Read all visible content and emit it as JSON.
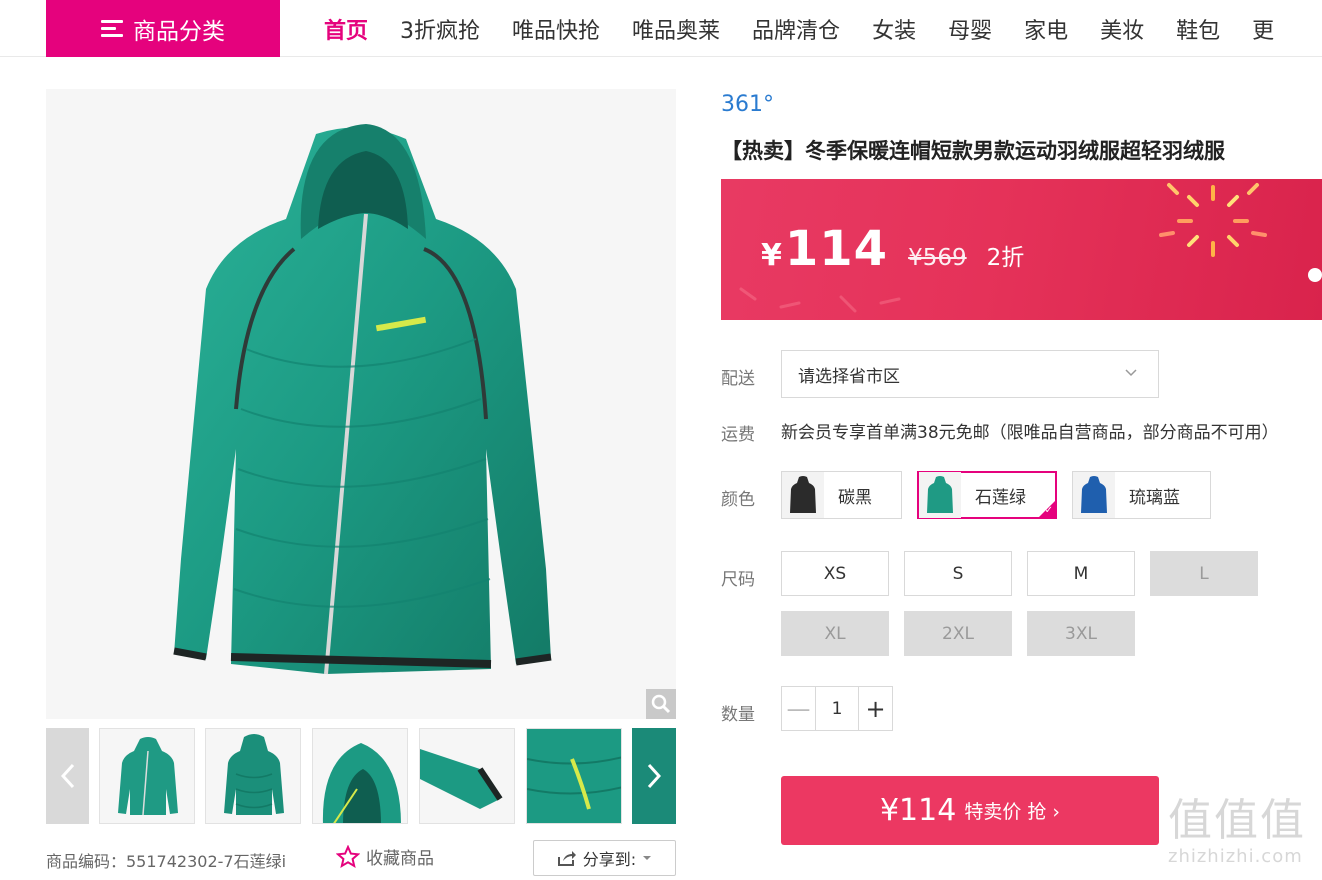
{
  "nav": {
    "category_button": "商品分类",
    "links": [
      "首页",
      "3折疯抢",
      "唯品快抢",
      "唯品奥莱",
      "品牌清仓",
      "女装",
      "母婴",
      "家电",
      "美妆",
      "鞋包",
      "更"
    ],
    "active_index": 0
  },
  "gallery": {
    "product_color_hex": "#1f9a84",
    "zoom_icon": "magnifier-icon",
    "thumbnail_count": 6
  },
  "product": {
    "brand": "361°",
    "title": "【热卖】冬季保暖连帽短款男款运动羽绒服超轻羽绒服",
    "currency": "¥",
    "price": "114",
    "original_price": "¥569",
    "discount": "2折"
  },
  "delivery": {
    "label": "配送",
    "placeholder": "请选择省市区"
  },
  "freight": {
    "label": "运费",
    "text": "新会员专享首单满38元免邮（限唯品自营商品，部分商品不可用）"
  },
  "colors": {
    "label": "颜色",
    "options": [
      {
        "name": "碳黑",
        "hex": "#2b2b2b",
        "selected": false
      },
      {
        "name": "石莲绿",
        "hex": "#1f9a84",
        "selected": true
      },
      {
        "name": "琉璃蓝",
        "hex": "#1f5fae",
        "selected": false
      }
    ]
  },
  "sizes": {
    "label": "尺码",
    "options": [
      {
        "name": "XS",
        "available": true
      },
      {
        "name": "S",
        "available": true
      },
      {
        "name": "M",
        "available": true
      },
      {
        "name": "L",
        "available": false
      },
      {
        "name": "XL",
        "available": false
      },
      {
        "name": "2XL",
        "available": false
      },
      {
        "name": "3XL",
        "available": false
      }
    ]
  },
  "quantity": {
    "label": "数量",
    "value": "1",
    "minus": "—",
    "plus": "+"
  },
  "buy": {
    "price": "¥114",
    "text": "特卖价 抢 ›"
  },
  "meta": {
    "sku": "商品编码：551742302-7石莲绿i",
    "favorite": "收藏商品",
    "share": "分享到:"
  },
  "watermark": {
    "big": "值值值",
    "small": "zhizhizhi.com"
  },
  "colors_theme": {
    "accent": "#e5027d",
    "buy_button": "#ec3862",
    "brand_link": "#2a7bd0"
  }
}
